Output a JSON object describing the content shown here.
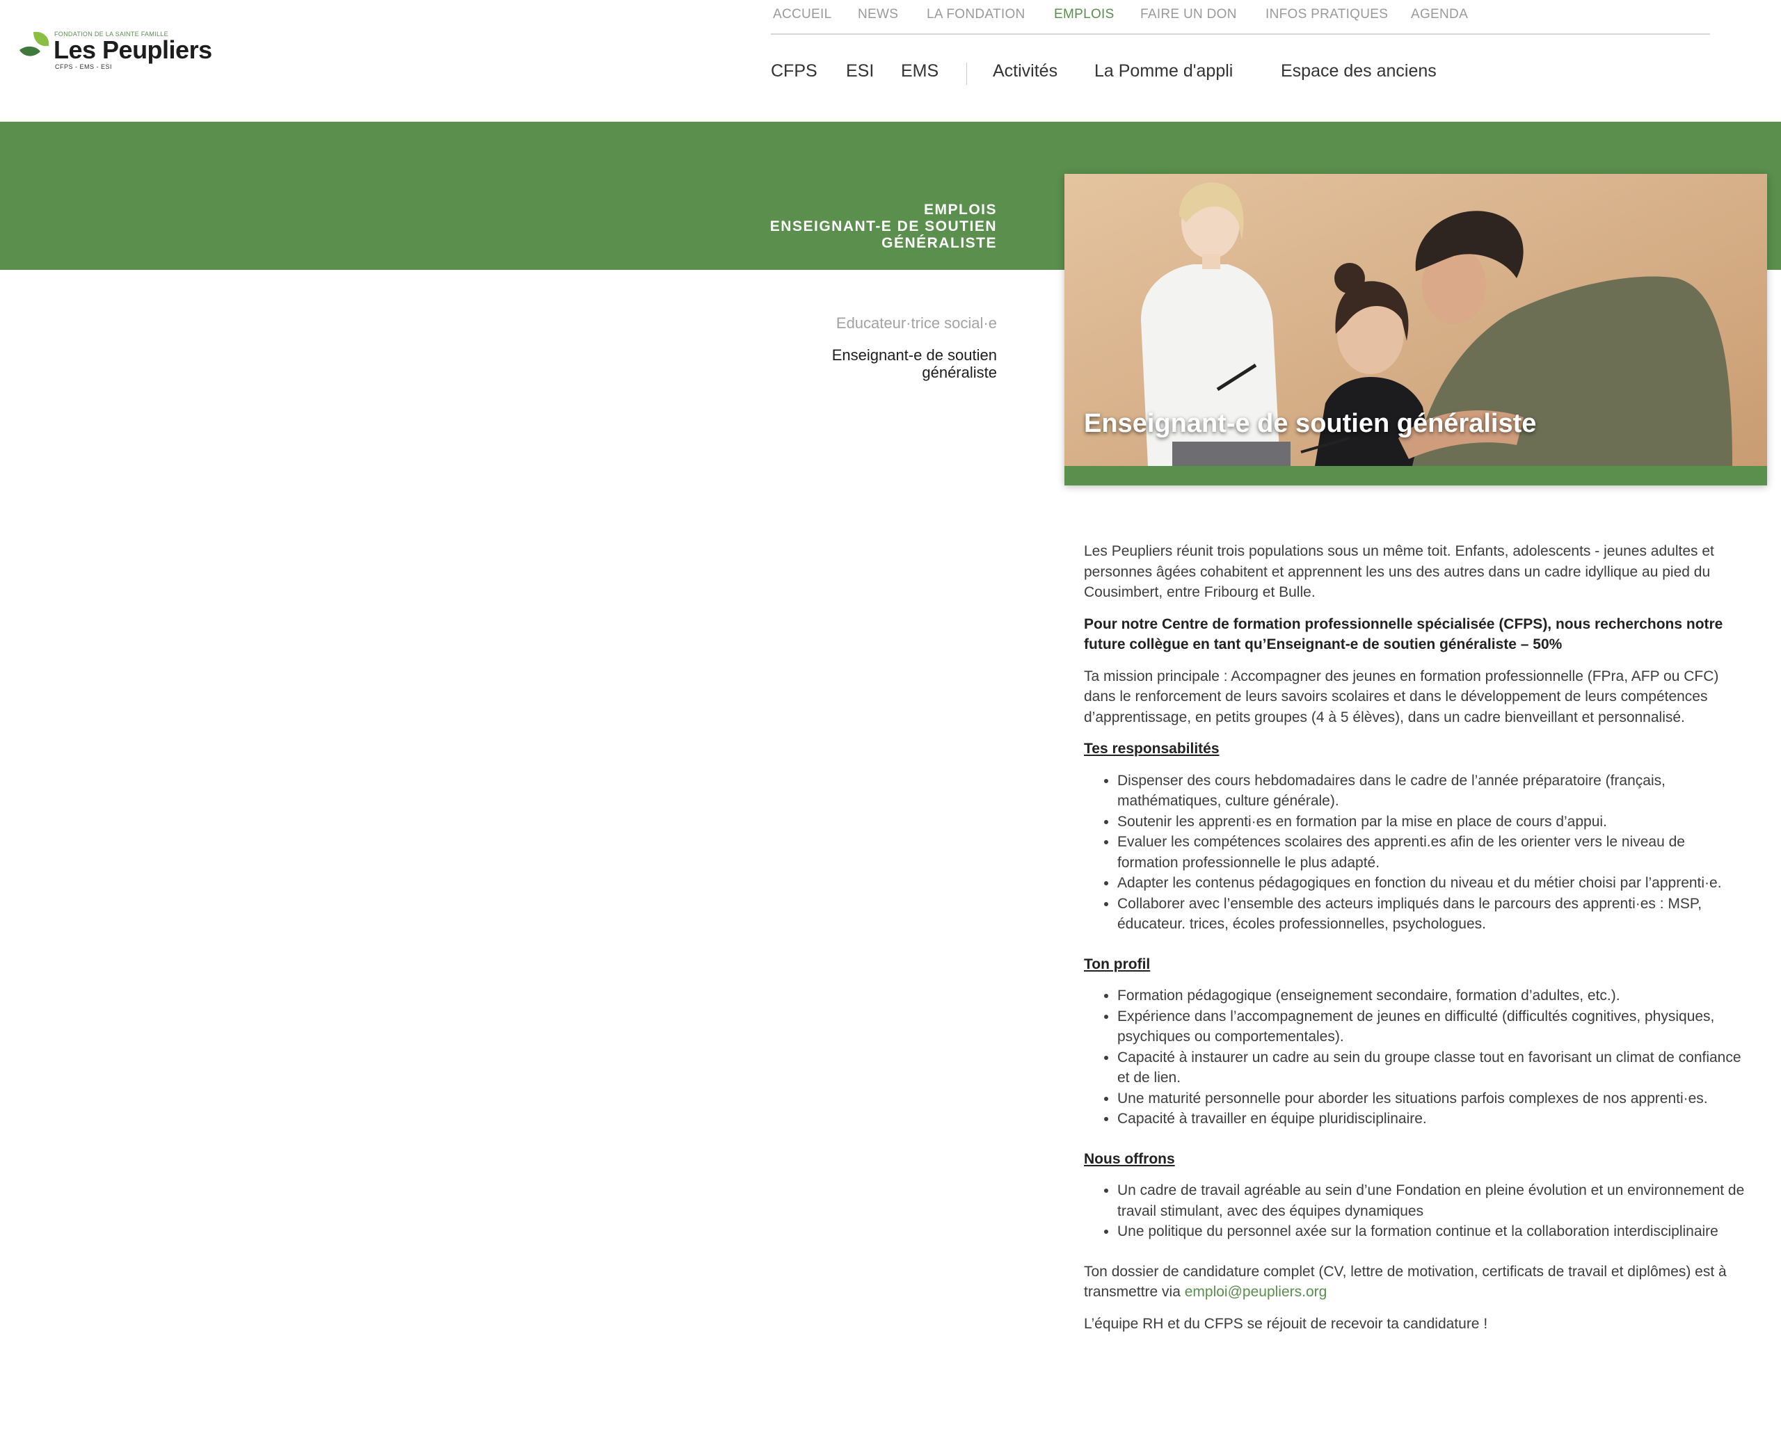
{
  "brand": {
    "super": "FONDATION DE LA SAINTE FAMILLE",
    "name": "Les Peupliers",
    "sub": "CFPS - EMS - ESI",
    "color": "#5a8f4e"
  },
  "top_nav": [
    {
      "label": "ACCUEIL"
    },
    {
      "label": "NEWS"
    },
    {
      "label": "LA FONDATION"
    },
    {
      "label": "EMPLOIS",
      "active": true
    },
    {
      "label": "FAIRE UN DON"
    },
    {
      "label": "INFOS PRATIQUES"
    },
    {
      "label": "AGENDA"
    }
  ],
  "main_nav": [
    {
      "label": "CFPS"
    },
    {
      "label": "ESI"
    },
    {
      "label": "EMS"
    },
    {
      "label": "Activités"
    },
    {
      "label": "La Pomme d'appli"
    },
    {
      "label": "Espace des anciens"
    }
  ],
  "hero": {
    "breadcrumb": [
      "EMPLOIS",
      "ENSEIGNANT-E DE SOUTIEN",
      "GÉNÉRALISTE"
    ],
    "image_title": "Enseignant-e de soutien généraliste"
  },
  "side_menu": [
    {
      "label": "Educateur·trice social·e",
      "current": false
    },
    {
      "label_lines": [
        "Enseignant-e de soutien",
        "généraliste"
      ],
      "current": true
    }
  ],
  "content": {
    "intro": "Les Peupliers réunit trois populations sous un même toit. Enfants, adolescents - jeunes adultes et personnes âgées cohabitent et apprennent les uns des autres dans un cadre idyllique au pied du Cousimbert, entre Fribourg et Bulle.",
    "highlight": "Pour notre Centre de formation professionnelle spécialisée (CFPS), nous recherchons notre future collègue en tant qu’Enseignant-e de soutien généraliste – 50%",
    "mission": "Ta mission principale : Accompagner des jeunes en formation professionnelle (FPra, AFP ou CFC) dans le renforcement de leurs savoirs scolaires et dans le développement de leurs compétences d’apprentissage, en petits groupes (4 à 5 élèves), dans un cadre bienveillant et personnalisé.",
    "responsibilities": {
      "heading": "Tes responsabilités",
      "items": [
        "Dispenser des cours hebdomadaires dans le cadre de l’année préparatoire (français, mathématiques, culture générale).",
        "Soutenir les apprenti·es en formation par la mise en place de cours d’appui.",
        "Evaluer les compétences scolaires des apprenti.es afin de les orienter vers le niveau de formation professionnelle le plus adapté.",
        "Adapter les contenus pédagogiques en fonction du niveau et du métier choisi par l’apprenti·e.",
        "Collaborer avec l’ensemble des acteurs impliqués dans le parcours des apprenti·es : MSP, éducateur. trices, écoles professionnelles, psychologues."
      ]
    },
    "profile": {
      "heading": "Ton profil",
      "items": [
        "Formation pédagogique (enseignement secondaire, formation d’adultes, etc.).",
        "Expérience dans l’accompagnement de jeunes en difficulté (difficultés cognitives, physiques, psychiques ou comportementales).",
        "Capacité à instaurer un cadre au sein du groupe classe tout en favorisant un climat de confiance et de lien.",
        "Une maturité personnelle pour aborder les situations parfois complexes de nos apprenti·es.",
        "Capacité à travailler en équipe pluridisciplinaire."
      ]
    },
    "offer": {
      "heading": "Nous offrons",
      "items": [
        "Un cadre de travail agréable au sein d’une Fondation en pleine évolution et un environnement de travail stimulant, avec des équipes dynamiques",
        "Une politique du personnel axée sur la formation continue et la collaboration interdisciplinaire"
      ]
    },
    "application_text": "Ton dossier de candidature complet (CV, lettre de motivation, certificats de travail et diplômes) est à transmettre via",
    "email": "emploi@peupliers.org",
    "closing": "L’équipe RH et du CFPS se réjouit de recevoir ta candidature !"
  }
}
